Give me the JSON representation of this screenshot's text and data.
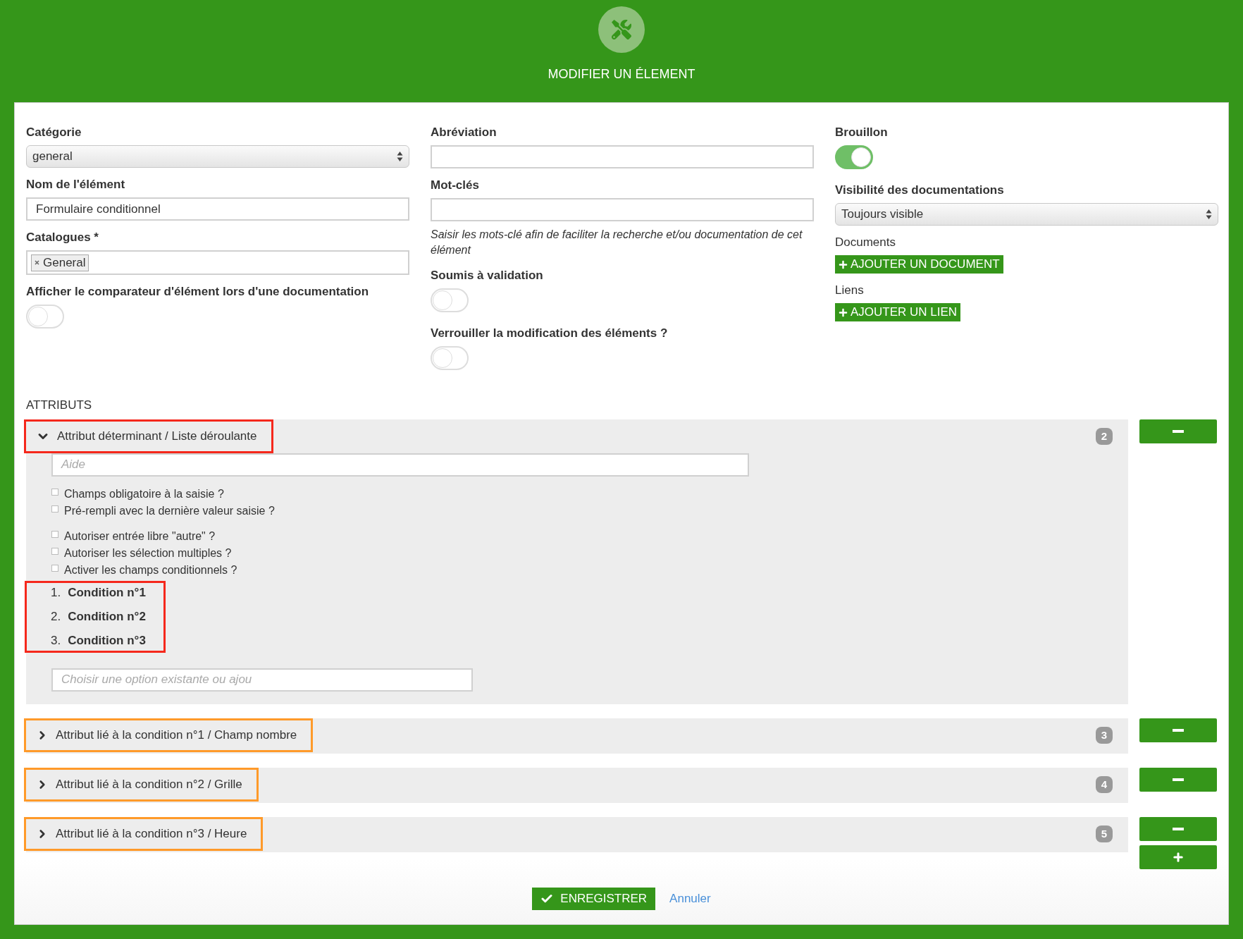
{
  "header": {
    "title": "MODIFIER UN ÉLEMENT"
  },
  "columns": [
    {
      "fields": [
        {
          "kind": "select",
          "label": "Catégorie",
          "value": "general"
        },
        {
          "kind": "input",
          "label": "Nom de l'élément",
          "value": "Formulaire conditionnel"
        },
        {
          "kind": "tags",
          "label": "Catalogues *",
          "tags": [
            "General"
          ]
        },
        {
          "kind": "toggle",
          "label": "Afficher le comparateur d'élément lors d'une documentation",
          "on": false
        }
      ]
    },
    {
      "fields": [
        {
          "kind": "input",
          "label": "Abréviation"
        },
        {
          "kind": "input",
          "label": "Mot-clés",
          "hint": "Saisir les mots-clé afin de faciliter la recherche et/ou documentation de cet élément"
        },
        {
          "kind": "toggle",
          "label": "Soumis à validation",
          "on": false
        },
        {
          "kind": "toggle",
          "label": "Verrouiller la modification des éléments ?",
          "on": false
        }
      ]
    },
    {
      "fields": [
        {
          "kind": "toggle",
          "label": "Brouillon",
          "on": true
        },
        {
          "kind": "select",
          "label": "Visibilité des documentations",
          "value": "Toujours visible"
        },
        {
          "kind": "attachment",
          "label": "Documents",
          "button": "AJOUTER UN DOCUMENT"
        },
        {
          "kind": "attachment",
          "label": "Liens",
          "button": "AJOUTER UN LIEN"
        }
      ]
    }
  ],
  "attributes": {
    "heading": "ATTRIBUTS",
    "items": [
      {
        "title": "Attribut déterminant / Liste déroulante",
        "expanded": true,
        "badge": "2",
        "color": "#f5281c",
        "help_placeholder": "Aide",
        "option_groups": [
          [
            {
              "label": "Champs obligatoire à la saisie ?",
              "checked": false
            },
            {
              "label": "Pré-rempli avec la dernière valeur saisie ?",
              "checked": false
            }
          ],
          [
            {
              "label": "Autoriser entrée libre \"autre\" ?",
              "checked": false
            },
            {
              "label": "Autoriser les sélection multiples ?",
              "checked": false
            },
            {
              "label": "Activer les champs conditionnels ?",
              "checked": false
            }
          ]
        ],
        "conditions": {
          "color": "#f5281c",
          "items": [
            {
              "number": "1.",
              "label": "Condition n°1"
            },
            {
              "number": "2.",
              "label": "Condition n°2"
            },
            {
              "number": "3.",
              "label": "Condition n°3"
            }
          ]
        },
        "option_placeholder": "Choisir une option existante ou ajou"
      },
      {
        "title": "Attribut lié à la condition n°1 / Champ nombre",
        "expanded": false,
        "badge": "3",
        "color": "#ff9a2a"
      },
      {
        "title": "Attribut lié à la condition n°2 / Grille",
        "expanded": false,
        "badge": "4",
        "color": "#ff9a2a"
      },
      {
        "title": "Attribut lié à la condition n°3 / Heure",
        "expanded": false,
        "badge": "5",
        "color": "#ff9a2a"
      }
    ]
  },
  "footer": {
    "save": "ENREGISTRER",
    "cancel": "Annuler"
  }
}
